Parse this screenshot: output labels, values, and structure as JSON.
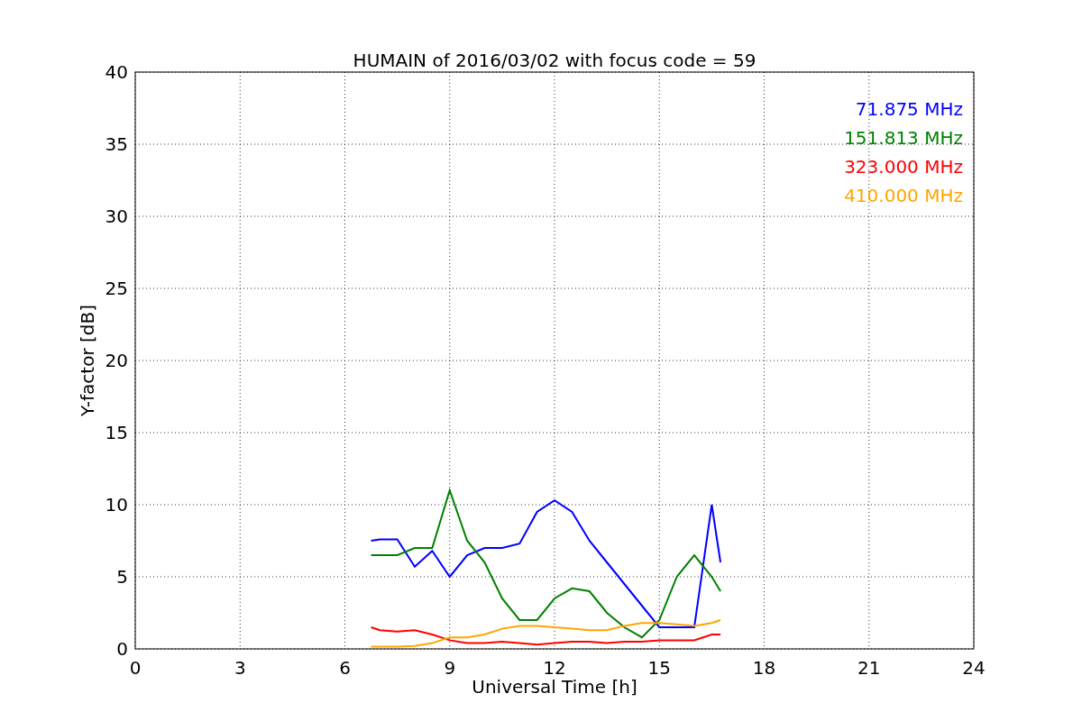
{
  "figure": {
    "chart_data": {
      "type": "line",
      "title": "HUMAIN of 2016/03/02 with focus code = 59",
      "xlabel": "Universal Time [h]",
      "ylabel": "Y-factor [dB]",
      "x": [
        6.75,
        7,
        7.5,
        8,
        8.5,
        9,
        9.5,
        10,
        10.5,
        11,
        11.5,
        12,
        12.5,
        13,
        13.5,
        14,
        14.5,
        15,
        15.5,
        16,
        16.5,
        16.75
      ],
      "series": [
        {
          "name": "71.875 MHz",
          "color": "#0000ff",
          "values": [
            7.5,
            7.6,
            7.6,
            5.7,
            6.8,
            5.0,
            6.5,
            7.0,
            7.0,
            7.3,
            9.5,
            10.3,
            9.5,
            7.5,
            6.0,
            4.5,
            3.0,
            1.5,
            1.5,
            1.5,
            10.0,
            6.0
          ]
        },
        {
          "name": "151.813 MHz",
          "color": "#008000",
          "values": [
            6.5,
            6.5,
            6.5,
            7.0,
            7.0,
            11.0,
            7.5,
            6.0,
            3.5,
            2.0,
            2.0,
            3.5,
            4.2,
            4.0,
            2.5,
            1.5,
            0.8,
            2.0,
            5.0,
            6.5,
            5.0,
            4.0
          ]
        },
        {
          "name": "323.000 MHz",
          "color": "#ff0000",
          "values": [
            1.5,
            1.3,
            1.2,
            1.3,
            1.0,
            0.6,
            0.4,
            0.4,
            0.5,
            0.4,
            0.3,
            0.4,
            0.5,
            0.5,
            0.4,
            0.5,
            0.5,
            0.6,
            0.6,
            0.6,
            1.0,
            1.0
          ]
        },
        {
          "name": "410.000 MHz",
          "color": "#ffa500",
          "values": [
            0.15,
            0.15,
            0.15,
            0.2,
            0.4,
            0.8,
            0.8,
            1.0,
            1.4,
            1.6,
            1.6,
            1.5,
            1.4,
            1.3,
            1.3,
            1.6,
            1.8,
            1.8,
            1.7,
            1.6,
            1.8,
            2.0
          ]
        }
      ],
      "grid": true,
      "xlim": [
        0,
        24
      ],
      "ylim": [
        0,
        40
      ],
      "xticks": [
        0,
        3,
        6,
        9,
        12,
        15,
        18,
        21,
        24
      ],
      "yticks": [
        0,
        5,
        10,
        15,
        20,
        25,
        30,
        35,
        40
      ]
    }
  }
}
